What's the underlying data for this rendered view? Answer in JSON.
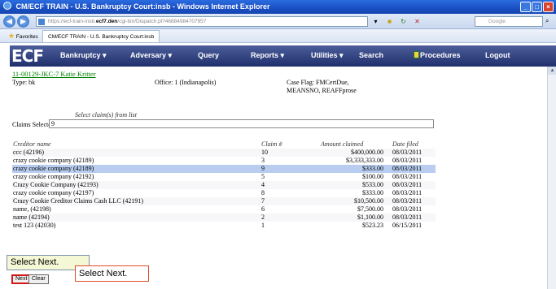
{
  "window": {
    "title": "CM/ECF TRAIN - U.S. Bankruptcy Court:insb - Windows Internet Explorer",
    "controls": [
      "_",
      "□",
      "×"
    ]
  },
  "browser": {
    "url_prefix": "https://ecf-train-insb.",
    "url_host": "ecf7.den",
    "url_rest": "/cgi-bin/Dispatch.pl?46884984707957",
    "search_placeholder": "Google",
    "favorites_label": "Favorites",
    "tab_label": "CM/ECF TRAIN - U.S. Bankruptcy Court:insb"
  },
  "menu": {
    "logo": "ECF",
    "items": [
      "Bankruptcy ▾",
      "Adversary ▾",
      "Query",
      "Reports ▾",
      "Utilities ▾",
      "Search",
      "Procedures",
      "Logout"
    ]
  },
  "case": {
    "number": "11-00129-JKC-7 Katie Kritter",
    "type": "Type: bk",
    "office": "Office: 1 (Indianapolis)",
    "flags_line1": "Case Flag: FMCertDue,",
    "flags_line2": "MEANSNO, REAFFprose"
  },
  "form": {
    "hint": "Select claim(s) from list",
    "claims_selected_label": "Claims Selected:",
    "claims_selected_value": "9"
  },
  "table": {
    "headers": [
      "Creditor name",
      "Claim #",
      "Amount claimed",
      "Date filed"
    ],
    "rows": [
      [
        "ccc    (42196)",
        "10",
        "$400,000.00",
        "08/03/2011"
      ],
      [
        "crazy cookie company    (42189)",
        "3",
        "$3,333,333.00",
        "08/03/2011"
      ],
      [
        "crazy cookie company    (42189)",
        "9",
        "$333.00",
        "08/03/2011"
      ],
      [
        "crazy cookie company    (42192)",
        "5",
        "$100.00",
        "08/03/2011"
      ],
      [
        "Crazy Cookie Company    (42193)",
        "4",
        "$533.00",
        "08/03/2011"
      ],
      [
        "crazy cookie company    (42197)",
        "8",
        "$333.00",
        "08/03/2011"
      ],
      [
        "Crazy Cookie Creditor Claims Cash LLC    (42191)",
        "7",
        "$10,500.00",
        "08/03/2011"
      ],
      [
        "name,    (42198)",
        "6",
        "$7,500.00",
        "08/03/2011"
      ],
      [
        "name    (42194)",
        "2",
        "$1,100.00",
        "08/03/2011"
      ],
      [
        "test 123    (42030)",
        "1",
        "$523.23",
        "06/15/2011"
      ]
    ],
    "selected_row": 2
  },
  "callouts": {
    "tooltip": "Select Next.",
    "boxed": "Select Next."
  },
  "buttons": {
    "next": "Next",
    "clear": "Clear"
  }
}
